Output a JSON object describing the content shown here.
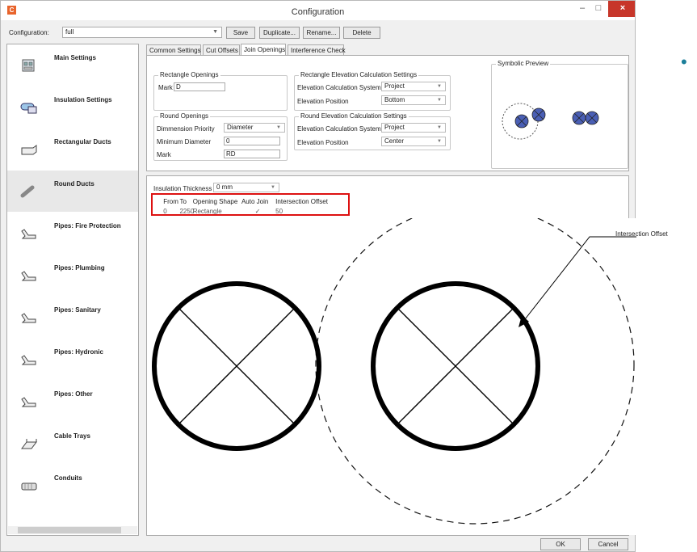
{
  "window": {
    "title": "Configuration",
    "close_glyph": "×",
    "min_glyph": "–",
    "max_glyph": "□",
    "accent_close": "#c7362a"
  },
  "config_bar": {
    "label": "Configuration:",
    "value": "full",
    "buttons": {
      "save": "Save",
      "duplicate": "Duplicate...",
      "rename": "Rename...",
      "delete": "Delete"
    }
  },
  "sidebar": {
    "items": [
      {
        "label": "Main Settings",
        "icon": "main-settings-icon"
      },
      {
        "label": "Insulation Settings",
        "icon": "insulation-icon"
      },
      {
        "label": "Rectangular Ducts",
        "icon": "rect-duct-icon"
      },
      {
        "label": "Round Ducts",
        "icon": "round-duct-icon",
        "selected": true
      },
      {
        "label": "Pipes: Fire Protection",
        "icon": "pipe-icon"
      },
      {
        "label": "Pipes: Plumbing",
        "icon": "pipe-icon"
      },
      {
        "label": "Pipes: Sanitary",
        "icon": "pipe-icon"
      },
      {
        "label": "Pipes: Hydronic",
        "icon": "pipe-icon"
      },
      {
        "label": "Pipes: Other",
        "icon": "pipe-icon"
      },
      {
        "label": "Cable Trays",
        "icon": "cable-tray-icon"
      },
      {
        "label": "Conduits",
        "icon": "conduit-icon"
      }
    ]
  },
  "tabs": [
    {
      "label": "Common Settings"
    },
    {
      "label": "Cut Offsets"
    },
    {
      "label": "Join Openings",
      "active": true
    },
    {
      "label": "Interference Check"
    }
  ],
  "rect_openings": {
    "title": "Rectangle Openings",
    "mark_label": "Mark",
    "mark_value": "D"
  },
  "round_openings": {
    "title": "Round Openings",
    "priority_label": "Dimmension Priority",
    "priority_value": "Diameter",
    "min_diam_label": "Minimum Diameter",
    "min_diam_value": "0",
    "mark_label": "Mark",
    "mark_value": "RD"
  },
  "rect_elev": {
    "title": "Rectangle Elevation Calculation Settings",
    "system_label": "Elevation Calculation System",
    "system_value": "Project",
    "position_label": "Elevation Position",
    "position_value": "Bottom"
  },
  "round_elev": {
    "title": "Round Elevation Calculation Settings",
    "system_label": "Elevation Calculation System",
    "system_value": "Project",
    "position_label": "Elevation Position",
    "position_value": "Center"
  },
  "symbolic_preview": {
    "title": "Symbolic Preview"
  },
  "insulation": {
    "label": "Insulation Thickness",
    "value": "0 mm"
  },
  "grid": {
    "headers": [
      "From",
      "To",
      "Opening Shape",
      "Auto Join",
      "Intersection Offset"
    ],
    "row": [
      "0",
      "2250",
      "Rectangle",
      "✓",
      "50"
    ]
  },
  "diagram": {
    "leader_label": "Intersection Offset"
  },
  "footer": {
    "ok": "OK",
    "cancel": "Cancel"
  },
  "slide": {
    "bullet": "•"
  }
}
